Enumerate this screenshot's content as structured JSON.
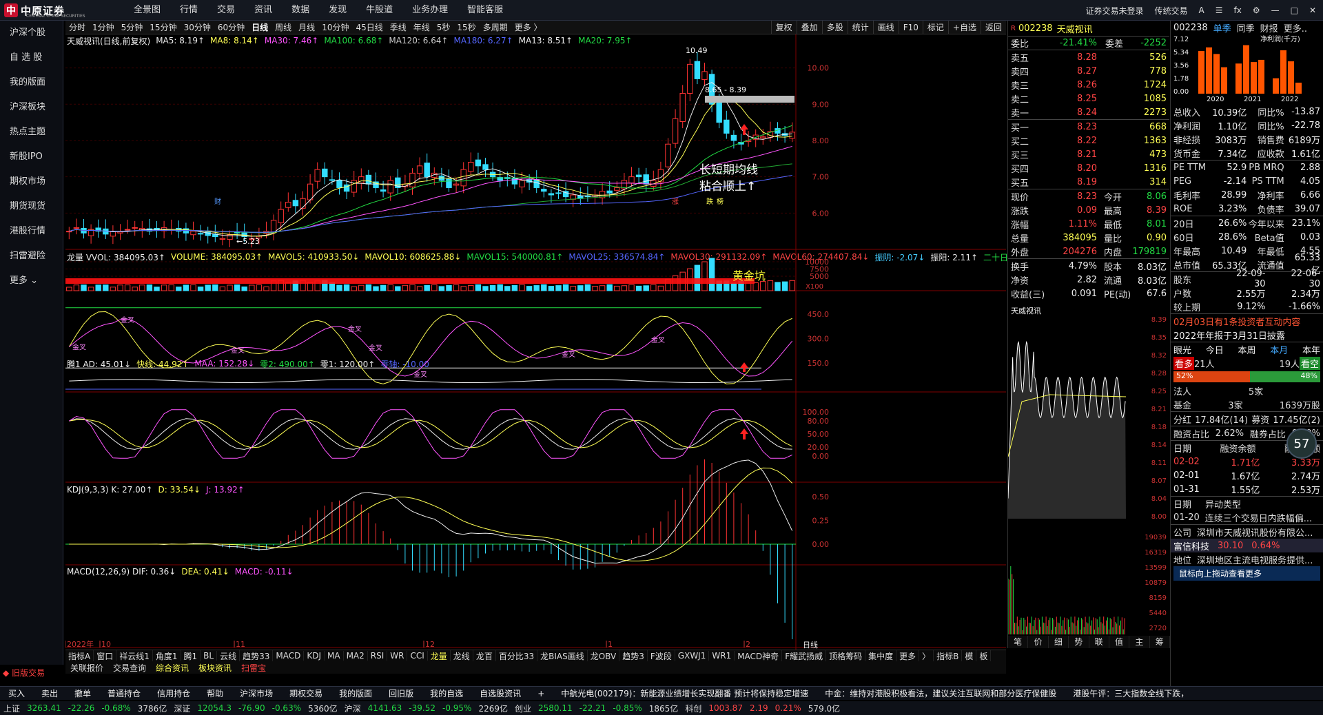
{
  "app": {
    "logo": "中原证券",
    "logo_sub": "CENTRAL CHINA SECURITIES"
  },
  "nav": [
    "全景图",
    "行情",
    "交易",
    "资讯",
    "数据",
    "发现",
    "牛股道",
    "业务办理",
    "智能客服"
  ],
  "topright": [
    "证券交易未登录",
    "传统交易",
    "A",
    "☰",
    "fx",
    "⚙",
    "—",
    "□",
    "✕"
  ],
  "sidebar": [
    "沪深个股",
    "自 选 股",
    "我的版面",
    "沪深板块",
    "热点主题",
    "新股IPO",
    "期权市场",
    "期货现货",
    "港股行情",
    "扫雷避险",
    "更多 ⌄"
  ],
  "old_trade": "旧版交易",
  "periods": [
    "分时",
    "1分钟",
    "5分钟",
    "15分钟",
    "30分钟",
    "60分钟",
    "日线",
    "周线",
    "月线",
    "10分钟",
    "45日线",
    "季线",
    "年线",
    "5秒",
    "15秒",
    "多周期",
    "更多 〉"
  ],
  "selected_period": "日线",
  "tools_right": [
    "复权",
    "叠加",
    "多股",
    "统计",
    "画线",
    "F10",
    "标记",
    "+自选",
    "返回"
  ],
  "main_legend": {
    "name": "天威视讯(日线,前复权)",
    "items": [
      {
        "t": "MA5: 8.19↑",
        "c": "#eeeeee"
      },
      {
        "t": "MA8: 8.14↑",
        "c": "#ffff55"
      },
      {
        "t": "MA30: 7.46↑",
        "c": "#ff55ff"
      },
      {
        "t": "MA100: 6.68↑",
        "c": "#22dd44"
      },
      {
        "t": "MA120: 6.64↑",
        "c": "#cccccc"
      },
      {
        "t": "MA180: 6.27↑",
        "c": "#5566ff"
      },
      {
        "t": "MA13: 8.51↑",
        "c": "#eeeeee"
      },
      {
        "t": "MA20: 7.95↑",
        "c": "#22dd44"
      }
    ]
  },
  "price_axis": [
    "10.00",
    "9.00",
    "8.00",
    "7.00",
    "6.00"
  ],
  "annot": {
    "high": "10.49",
    "low": "5.23",
    "range": "8.65 - 8.39",
    "note1": "长短期均线",
    "note2": "粘合顺上↑",
    "mark_cai": "财",
    "mark_zhang": "涨",
    "mark_die": "跌",
    "mark_bang": "榜"
  },
  "vol_legend": {
    "items": [
      {
        "t": "龙量 VVOL: 384095.03↑",
        "c": "#eeeeee"
      },
      {
        "t": "VOLUME: 384095.03↑",
        "c": "#ffff55"
      },
      {
        "t": "MAVOL5: 410933.50↓",
        "c": "#ffff55"
      },
      {
        "t": "MAVOL10: 608625.88↓",
        "c": "#ffff55"
      },
      {
        "t": "MAVOL15: 540000.81↑",
        "c": "#22dd44"
      },
      {
        "t": "MAVOL25: 336574.84↑",
        "c": "#5566ff"
      },
      {
        "t": "MAVOL30: 291132.09↑",
        "c": "#ff4545"
      },
      {
        "t": "MAVOL60: 274407.84↓",
        "c": "#ff4545"
      },
      {
        "t": "振阴: -2.07↓",
        "c": "#44ccff"
      },
      {
        "t": "振阳: 2.11↑",
        "c": "#eeeeee"
      },
      {
        "t": "二十日操作",
        "c": "#22dd44"
      }
    ]
  },
  "vol_axis": [
    "10000",
    "7500",
    "5000"
  ],
  "vol_unit": "X100",
  "gold": "黄金坑",
  "ad_legend": {
    "items": [
      {
        "t": "腾1 AD: 45.01↓",
        "c": "#eeeeee"
      },
      {
        "t": "快线: 44.92↑",
        "c": "#ffff55"
      },
      {
        "t": "MAA: 152.28↓",
        "c": "#ff55ff"
      },
      {
        "t": "零2: 490.00↑",
        "c": "#22dd44"
      },
      {
        "t": "零1: 120.00↑",
        "c": "#eeeeee"
      },
      {
        "t": "零轴: -10.00",
        "c": "#5566ff"
      }
    ]
  },
  "ad_axis": [
    "450.0",
    "300.0",
    "150.0"
  ],
  "ad_marks": [
    "金叉",
    "金叉",
    "金叉",
    "金叉",
    "金叉",
    "金叉",
    "金叉",
    "金叉"
  ],
  "kdj_legend": {
    "items": [
      {
        "t": "KDJ(9,3,3) K: 27.00↑",
        "c": "#eeeeee"
      },
      {
        "t": "D: 33.54↓",
        "c": "#ffff55"
      },
      {
        "t": "J: 13.92↑",
        "c": "#ff55ff"
      }
    ]
  },
  "kdj_axis": [
    "100.00",
    "80.00",
    "50.00",
    "20.00",
    "0.00"
  ],
  "macd_legend": {
    "items": [
      {
        "t": "MACD(12,26,9) DIF: 0.36↓",
        "c": "#eeeeee"
      },
      {
        "t": "DEA: 0.41↓",
        "c": "#ffff55"
      },
      {
        "t": "MACD: -0.11↓",
        "c": "#ff55ff"
      }
    ]
  },
  "macd_axis": [
    "0.50",
    "0.25",
    "0.00"
  ],
  "date_axis": [
    "2022年",
    "10",
    "11",
    "12",
    "1",
    "2"
  ],
  "date_axis_right": "日线",
  "bottom_tabs": [
    "指标A",
    "窗口",
    "祥云线1",
    "角度1",
    "腾1",
    "BL",
    "云线",
    "趋势33",
    "MACD",
    "KDJ",
    "MA",
    "MA2",
    "RSI",
    "WR",
    "CCI",
    "龙量",
    "龙线",
    "龙百",
    "百分比33",
    "龙BIAS画线",
    "龙OBV",
    "趋势3",
    "F波段",
    "GXWJ1",
    "WR1",
    "MACD神奇",
    "F耀武扬威",
    "顶格筹码",
    "集中度",
    "更多",
    "〉",
    "指标B",
    "模",
    "板"
  ],
  "bottom_tabs2": [
    "关联报价",
    "交易查询",
    "综合资讯",
    "板块资讯",
    "扫雷宝"
  ],
  "quote": {
    "code": "002238",
    "name": "天威视讯",
    "r": "R",
    "webi": {
      "label": "委比",
      "val": "-21.41%",
      "label2": "委差",
      "val2": "-2252"
    },
    "asks": [
      {
        "l": "卖五",
        "p": "8.28",
        "v": "526"
      },
      {
        "l": "卖四",
        "p": "8.27",
        "v": "778"
      },
      {
        "l": "卖三",
        "p": "8.26",
        "v": "1724"
      },
      {
        "l": "卖二",
        "p": "8.25",
        "v": "1085"
      },
      {
        "l": "卖一",
        "p": "8.24",
        "v": "2273"
      }
    ],
    "bids": [
      {
        "l": "买一",
        "p": "8.23",
        "v": "668"
      },
      {
        "l": "买二",
        "p": "8.22",
        "v": "1363"
      },
      {
        "l": "买三",
        "p": "8.21",
        "v": "473"
      },
      {
        "l": "买四",
        "p": "8.20",
        "v": "1316"
      },
      {
        "l": "买五",
        "p": "8.19",
        "v": "314"
      }
    ],
    "stats": [
      {
        "a": "现价",
        "b": "8.23",
        "bc": "#ff4545",
        "c": "今开",
        "d": "8.06",
        "dc": "#22dd44"
      },
      {
        "a": "涨跌",
        "b": "0.09",
        "bc": "#ff4545",
        "c": "最高",
        "d": "8.39",
        "dc": "#ff4545"
      },
      {
        "a": "涨幅",
        "b": "1.11%",
        "bc": "#ff4545",
        "c": "最低",
        "d": "8.01",
        "dc": "#22dd44"
      },
      {
        "a": "总量",
        "b": "384095",
        "bc": "#ffff55",
        "c": "量比",
        "d": "0.90",
        "dc": "#ffff55"
      },
      {
        "a": "外盘",
        "b": "204276",
        "bc": "#ff4545",
        "c": "内盘",
        "d": "179819",
        "dc": "#22dd44"
      }
    ],
    "stats2": [
      {
        "a": "换手",
        "b": "4.79%",
        "c": "股本",
        "d": "8.03亿"
      },
      {
        "a": "净资",
        "b": "2.82",
        "c": "流通",
        "d": "8.03亿"
      },
      {
        "a": "收益(三)",
        "b": "0.091",
        "c": "PE(动)",
        "d": "67.6"
      }
    ]
  },
  "mini": {
    "name": "天威视讯",
    "axis": [
      "8.39",
      "8.35",
      "8.32",
      "8.28",
      "8.25",
      "8.21",
      "8.18",
      "8.14",
      "8.11",
      "8.07",
      "8.04",
      "8.00"
    ],
    "vol_axis": [
      "19039",
      "16319",
      "13599",
      "10879",
      "8159",
      "5440",
      "2720"
    ]
  },
  "mini_tabs": [
    "笔",
    "价",
    "细",
    "势",
    "联",
    "值",
    "主",
    "筹"
  ],
  "right": {
    "code": "002238",
    "tabs": [
      "单季",
      "同季",
      "财报",
      "更多.."
    ],
    "chart": {
      "axis": [
        "7.12",
        "5.34",
        "3.56",
        "1.78",
        "0.00"
      ],
      "years": [
        "2020",
        "2021",
        "2022"
      ],
      "title": "净利润(千万)",
      "values": [
        5.8,
        6.3,
        5.4,
        3.6,
        4.1,
        6.6,
        4.3,
        4.6,
        2.1,
        5.9,
        4.4,
        1.5
      ]
    },
    "fin": [
      {
        "a": "总收入",
        "b": "10.39亿",
        "c": "同比%",
        "d": "-13.87"
      },
      {
        "a": "净利润",
        "b": "1.10亿",
        "c": "同比%",
        "d": "-22.78"
      },
      {
        "a": "非经损",
        "b": "3083万",
        "c": "销售费",
        "d": "6189万"
      },
      {
        "a": "货币金",
        "b": "7.34亿",
        "c": "应收款",
        "d": "1.61亿"
      }
    ],
    "val": [
      {
        "a": "PE TTM",
        "b": "52.9",
        "c": "PB MRQ",
        "d": "2.88"
      },
      {
        "a": "PEG",
        "b": "-2.14",
        "c": "PS TTM",
        "d": "4.05"
      },
      {
        "a": "毛利率",
        "b": "28.99",
        "c": "净利率",
        "d": "6.66"
      },
      {
        "a": "ROE",
        "b": "3.23%",
        "c": "负债率",
        "d": "39.07"
      }
    ],
    "perf": [
      {
        "a": "20日",
        "b": "26.6%",
        "c": "今年以来",
        "d": "23.1%"
      },
      {
        "a": "60日",
        "b": "28.6%",
        "c": "Beta值",
        "d": "0.03"
      },
      {
        "a": "年最高",
        "b": "10.49",
        "c": "年最低",
        "d": "4.55"
      },
      {
        "a": "总市值",
        "b": "65.33亿",
        "c": "流通值",
        "d": "65.33亿"
      }
    ],
    "holders": [
      {
        "a": "股东",
        "b": "22-09-30",
        "d": "22-06-30"
      },
      {
        "a": "户数",
        "b": "2.55万",
        "d": "2.34万"
      },
      {
        "a": "较上期",
        "b": "9.12%",
        "d": "-1.66%"
      }
    ],
    "news1": "02月03日有1条投资者互动内容",
    "news2": "2022年年报于3月31日披露",
    "sent": {
      "label": "眼光",
      "t1": "今日",
      "t2": "本周",
      "t3": "本月",
      "t4": "本年",
      "bull": "看多",
      "bull_n": "21人",
      "bear_n": "19人",
      "bear": "看空",
      "bull_pct": "52%",
      "bear_pct": "48%"
    },
    "inst": [
      {
        "a": "法人",
        "b": "5家",
        "d": ""
      },
      {
        "a": "基金",
        "b": "3家",
        "d": "1639万股"
      }
    ],
    "circle": "57",
    "red_row": {
      "a": "分红",
      "b": "17.84亿(14)",
      "c": "募资",
      "d": "17.45亿(2)"
    },
    "margin_head": {
      "a": "融资占比",
      "b": "2.62%",
      "c": "融券占比",
      "d": "0.00%"
    },
    "margin_cols": [
      "日期",
      "融资余额",
      "融券余额"
    ],
    "margin": [
      {
        "a": "02-02",
        "b": "1.71亿",
        "d": "3.33万"
      },
      {
        "a": "02-01",
        "b": "1.67亿",
        "d": "2.74万"
      },
      {
        "a": "01-31",
        "b": "1.55亿",
        "d": "2.53万"
      }
    ],
    "anomaly_cols": [
      "日期",
      "异动类型"
    ],
    "anomaly": {
      "a": "01-20",
      "b": "连续三个交易日内跌幅偏..."
    },
    "company": {
      "a": "公司",
      "b": "深圳市天威视讯股份有限公..."
    },
    "industry": {
      "tag": "富信科技",
      "p": "30.10",
      "pct": "0.64%"
    },
    "region": {
      "a": "地位",
      "b": "深圳地区主流电视服务提供..."
    },
    "tooltip": "鼠标向上拖动查看更多"
  },
  "status1": {
    "items": [
      {
        "t": "买入",
        "c": "#eeeeee"
      },
      {
        "t": "卖出",
        "c": "#eeeeee"
      },
      {
        "t": "撤单",
        "c": "#eeeeee"
      },
      {
        "t": "普通持仓",
        "c": "#eeeeee"
      },
      {
        "t": "信用持仓",
        "c": "#eeeeee"
      },
      {
        "t": "帮助",
        "c": "#eeeeee"
      },
      {
        "t": "沪深市场",
        "c": "#eeeeee"
      },
      {
        "t": "期权交易",
        "c": "#eeeeee"
      },
      {
        "t": "我的版面",
        "c": "#eeeeee"
      },
      {
        "t": "回旧版",
        "c": "#eeeeee"
      },
      {
        "t": "我的自选",
        "c": "#eeeeee"
      },
      {
        "t": "自选股资讯",
        "c": "#eeeeee"
      },
      {
        "t": "+",
        "c": "#eeeeee"
      }
    ],
    "ticker": "中航光电(002179)：新能源业绩增长实现翻番 预计将保持稳定增速",
    "ticker2": "中金：维持对港股积极看法，建议关注互联网和部分医疗保健股",
    "ticker3": "港股午评：三大指数全线下跌，"
  },
  "status2": [
    {
      "t": "上证",
      "c": "#ddd"
    },
    {
      "t": "3263.41",
      "c": "#22dd44"
    },
    {
      "t": "-22.26",
      "c": "#22dd44"
    },
    {
      "t": "-0.68%",
      "c": "#22dd44"
    },
    {
      "t": "3786亿",
      "c": "#ddd"
    },
    {
      "t": "深证",
      "c": "#ddd"
    },
    {
      "t": "12054.3",
      "c": "#22dd44"
    },
    {
      "t": "-76.90",
      "c": "#22dd44"
    },
    {
      "t": "-0.63%",
      "c": "#22dd44"
    },
    {
      "t": "5360亿",
      "c": "#ddd"
    },
    {
      "t": "沪深",
      "c": "#ddd"
    },
    {
      "t": "4141.63",
      "c": "#22dd44"
    },
    {
      "t": "-39.52",
      "c": "#22dd44"
    },
    {
      "t": "-0.95%",
      "c": "#22dd44"
    },
    {
      "t": "2269亿",
      "c": "#ddd"
    },
    {
      "t": "创业",
      "c": "#ddd"
    },
    {
      "t": "2580.11",
      "c": "#22dd44"
    },
    {
      "t": "-22.21",
      "c": "#22dd44"
    },
    {
      "t": "-0.85%",
      "c": "#22dd44"
    },
    {
      "t": "1865亿",
      "c": "#ddd"
    },
    {
      "t": "科创",
      "c": "#ddd"
    },
    {
      "t": "1003.87",
      "c": "#ff4545"
    },
    {
      "t": "2.19",
      "c": "#ff4545"
    },
    {
      "t": "0.21%",
      "c": "#ff4545"
    },
    {
      "t": "579.0亿",
      "c": "#ddd"
    }
  ],
  "chart_data": {
    "type": "candlestick",
    "x_labels": [
      "2022年",
      "10",
      "11",
      "12",
      "1",
      "2"
    ],
    "ylim": [
      5.0,
      10.6
    ],
    "high": 10.49,
    "low": 5.23,
    "closes": [
      5.5,
      5.6,
      5.45,
      5.55,
      5.5,
      5.42,
      5.5,
      5.48,
      5.55,
      5.6,
      5.58,
      5.5,
      5.52,
      5.6,
      5.55,
      5.5,
      5.45,
      5.5,
      5.42,
      5.38,
      5.35,
      5.3,
      5.4,
      5.45,
      5.35,
      5.3,
      5.36,
      5.5,
      5.8,
      6.1,
      6.3,
      6.2,
      6.4,
      6.8,
      7.2,
      7.0,
      6.9,
      6.7,
      6.6,
      6.9,
      7.0,
      6.8,
      6.7,
      6.6,
      6.9,
      6.7,
      6.8,
      7.1,
      7.3,
      7.0,
      7.1,
      6.9,
      6.7,
      6.8,
      7.2,
      7.4,
      7.3,
      7.2,
      7.0,
      6.9,
      6.95,
      6.8,
      6.9,
      6.85,
      6.7,
      6.6,
      6.5,
      6.55,
      6.45,
      6.5,
      6.4,
      6.45,
      6.5,
      6.6,
      6.55,
      6.7,
      6.9,
      7.0,
      7.0,
      6.8,
      6.9,
      7.2,
      7.9,
      8.6,
      9.3,
      10.1,
      9.7,
      9.9,
      9.0,
      8.5,
      8.2,
      8.0,
      7.9,
      8.0,
      8.15,
      8.1,
      8.25,
      8.2,
      8.14,
      8.23
    ]
  }
}
